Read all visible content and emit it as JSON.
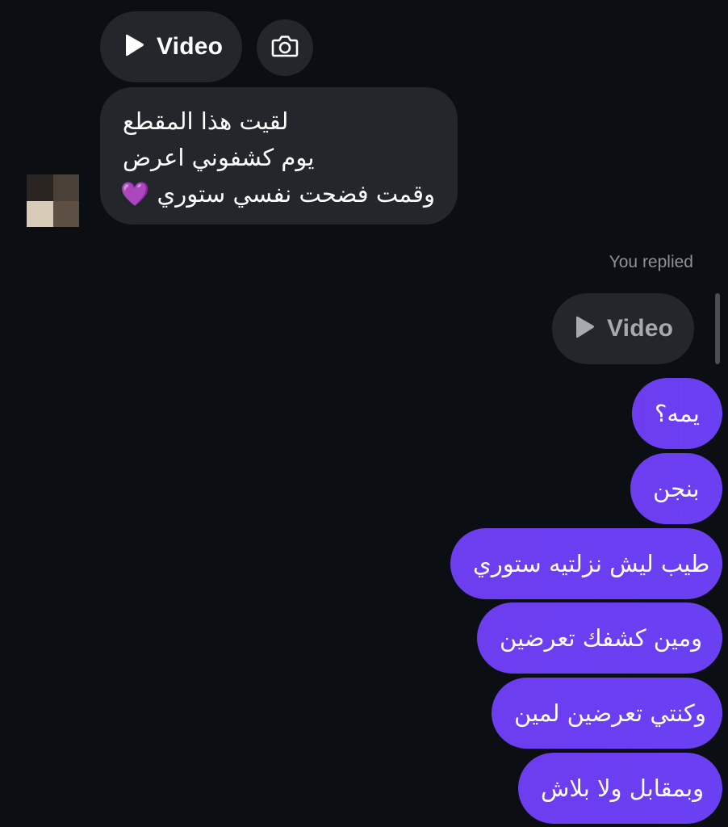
{
  "thread": {
    "incoming_video": {
      "label": "Video",
      "icon": "play-icon"
    },
    "camera_button": {
      "icon": "camera-icon"
    },
    "incoming_message": {
      "lines": [
        "لقيت هذا المقطع",
        "يوم كشفوني اعرض",
        "وقمت فضحت نفسي ستوري"
      ],
      "emoji": "💜"
    },
    "avatar": {
      "colors": [
        "#2a2521",
        "#4b4038",
        "#d8ccb8",
        "#5d4f43"
      ]
    },
    "reply_status": "You replied",
    "outgoing_video": {
      "label": "Video",
      "icon": "play-icon"
    },
    "outgoing_messages": [
      "يمه؟",
      "بنجن",
      "طيب ليش نزلتيه ستوري",
      "ومين كشفك تعرضين",
      "وكنتي تعرضين لمين",
      "وبمقابل ولا بلاش"
    ]
  },
  "colors": {
    "background": "#0b0f14",
    "incoming_bubble": "#23272c",
    "outgoing_bubble": "#6c3ef1",
    "muted_text": "#8e9297"
  }
}
